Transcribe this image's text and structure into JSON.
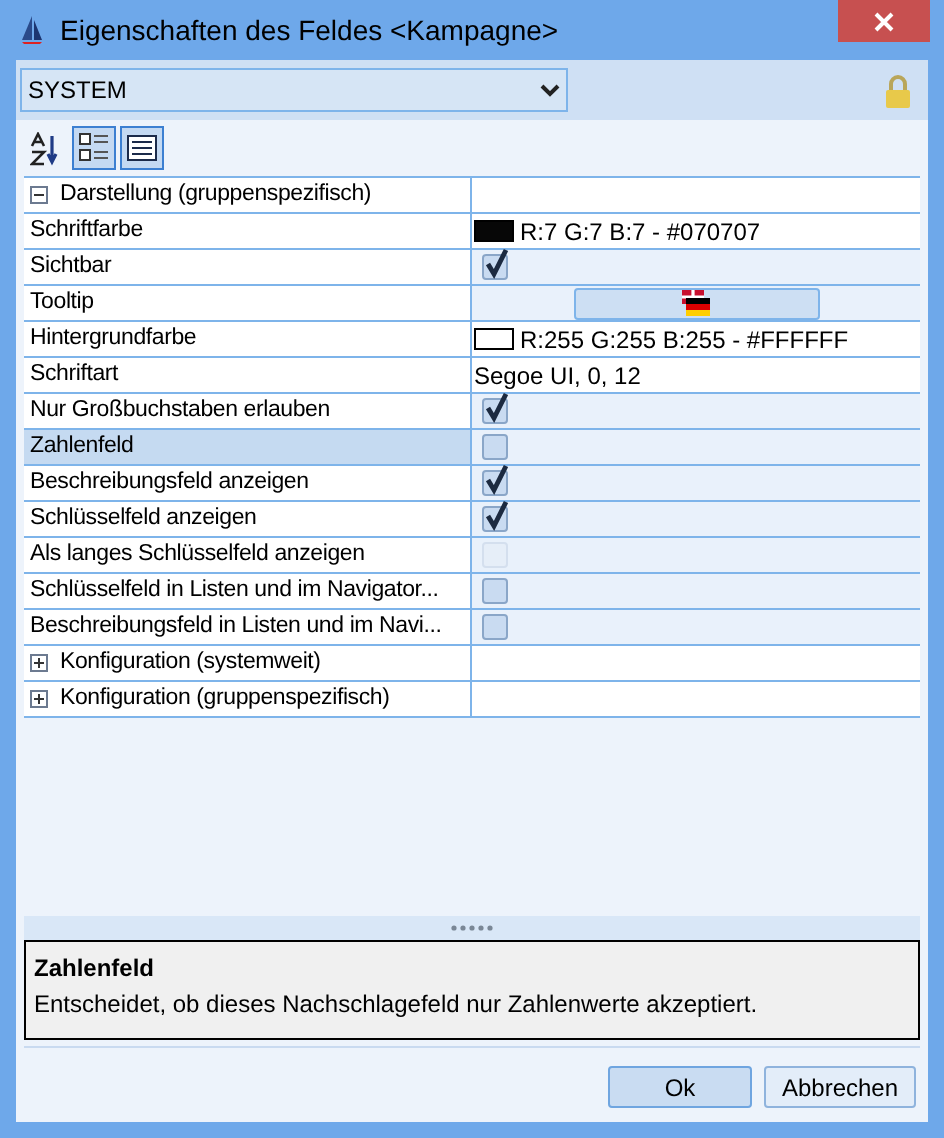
{
  "window": {
    "title": "Eigenschaften des Feldes <Kampagne>"
  },
  "scope": {
    "value": "SYSTEM",
    "locked": true
  },
  "toolbar": [
    {
      "kind": "sort",
      "selected": false
    },
    {
      "kind": "categorized",
      "selected": true
    },
    {
      "kind": "pages",
      "selected": true
    }
  ],
  "properties": [
    {
      "kind": "group",
      "name": "Darstellung (gruppenspezifisch)",
      "expanded": true,
      "selected": false
    },
    {
      "kind": "color",
      "name": "Schriftfarbe",
      "color": "#070707",
      "value": "R:7 G:7 B:7 - #070707",
      "selected": false
    },
    {
      "kind": "check",
      "name": "Sichtbar",
      "checked": true,
      "disabled": false,
      "selected": false
    },
    {
      "kind": "flag",
      "name": "Tooltip",
      "selected": false
    },
    {
      "kind": "color",
      "name": "Hintergrundfarbe",
      "color": "#ffffff",
      "value": "R:255 G:255 B:255 - #FFFFFF",
      "selected": false
    },
    {
      "kind": "text",
      "name": "Schriftart",
      "value": "Segoe UI, 0, 12",
      "selected": false
    },
    {
      "kind": "check",
      "name": "Nur Großbuchstaben erlauben",
      "checked": true,
      "disabled": false,
      "selected": false
    },
    {
      "kind": "check",
      "name": "Zahlenfeld",
      "checked": false,
      "disabled": false,
      "selected": true
    },
    {
      "kind": "check",
      "name": "Beschreibungsfeld anzeigen",
      "checked": true,
      "disabled": false,
      "selected": false
    },
    {
      "kind": "check",
      "name": "Schlüsselfeld anzeigen",
      "checked": true,
      "disabled": false,
      "selected": false
    },
    {
      "kind": "check",
      "name": "Als langes Schlüsselfeld anzeigen",
      "checked": false,
      "disabled": true,
      "selected": false
    },
    {
      "kind": "check",
      "name": "Schlüsselfeld in Listen und im Navigator...",
      "checked": false,
      "disabled": false,
      "selected": false
    },
    {
      "kind": "check",
      "name": "Beschreibungsfeld in Listen und im Navi...",
      "checked": false,
      "disabled": false,
      "selected": false
    },
    {
      "kind": "group",
      "name": "Konfiguration (systemweit)",
      "expanded": false,
      "selected": false
    },
    {
      "kind": "group",
      "name": "Konfiguration (gruppenspezifisch)",
      "expanded": false,
      "selected": false
    }
  ],
  "description": {
    "title": "Zahlenfeld",
    "text": "Entscheidet, ob dieses Nachschlagefeld nur Zahlenwerte akzeptiert."
  },
  "buttons": [
    {
      "label": "Ok",
      "default": true
    },
    {
      "label": "Abbrechen",
      "default": false
    }
  ]
}
